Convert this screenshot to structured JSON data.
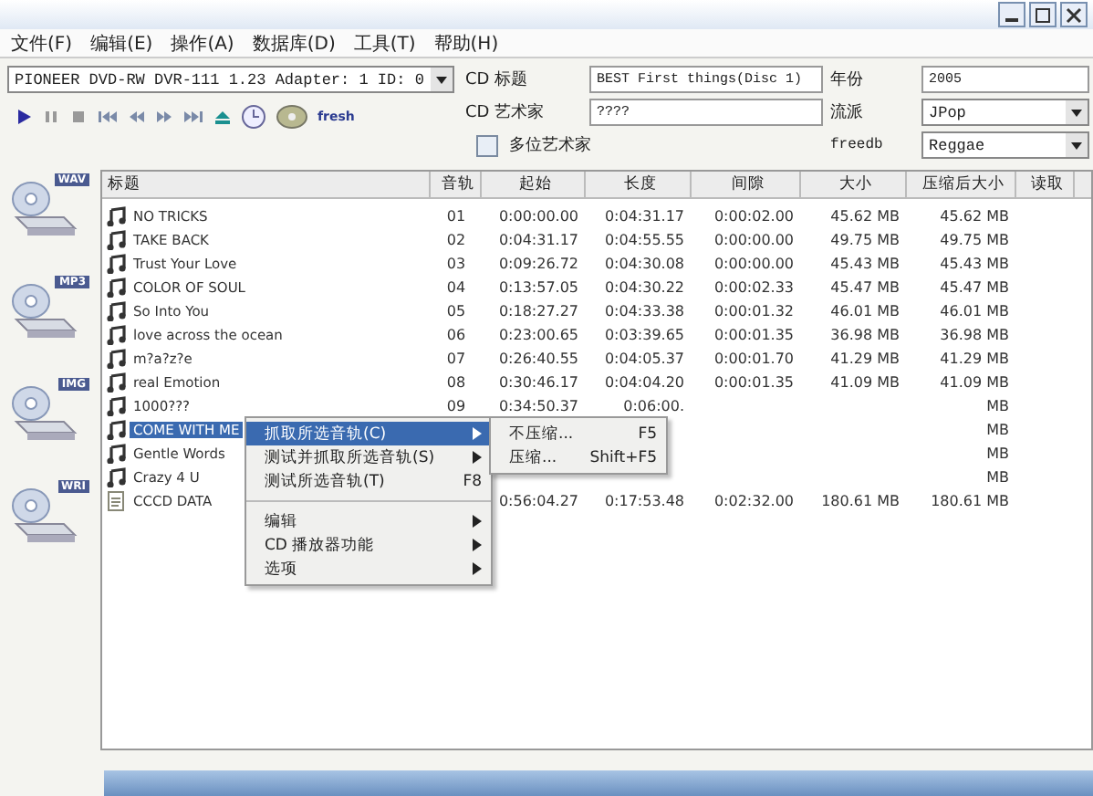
{
  "menu": [
    "文件(F)",
    "编辑(E)",
    "操作(A)",
    "数据库(D)",
    "工具(T)",
    "帮助(H)"
  ],
  "drive": {
    "value": "PIONEER DVD-RW  DVR-111 1.23   Adapter: 1  ID: 0"
  },
  "transport": [
    {
      "kind": "play"
    },
    {
      "kind": "pause"
    },
    {
      "kind": "stop"
    },
    {
      "kind": "first"
    },
    {
      "kind": "rew"
    },
    {
      "kind": "ff"
    },
    {
      "kind": "last"
    },
    {
      "kind": "eject"
    },
    {
      "kind": "clock"
    },
    {
      "kind": "cd"
    },
    {
      "kind": "text",
      "label": "fresh"
    }
  ],
  "cd_title": {
    "label": "CD 标题",
    "value": "BEST First things(Disc 1)"
  },
  "cd_artist": {
    "label": "CD 艺术家",
    "value": "????"
  },
  "multi_artist": {
    "label": "多位艺术家",
    "checked": false
  },
  "year": {
    "label": "年份",
    "value": "2005"
  },
  "genre": {
    "label": "流派",
    "value": "JPop"
  },
  "freedb": {
    "label": "freedb",
    "value": "Reggae"
  },
  "side_icons": [
    {
      "badge": "WAV"
    },
    {
      "badge": "MP3"
    },
    {
      "badge": "IMG"
    },
    {
      "badge": "WRI"
    }
  ],
  "table": {
    "columns": [
      "标题",
      "音轨",
      "起始",
      "长度",
      "间隙",
      "大小",
      "压缩后大小",
      "读取"
    ],
    "rows": [
      {
        "kind": "audio",
        "selected": false,
        "cells": [
          "NO TRICKS",
          "01",
          "0:00:00.00",
          "0:04:31.17",
          "0:00:02.00",
          "45.62 MB",
          "45.62 MB"
        ]
      },
      {
        "kind": "audio",
        "selected": false,
        "cells": [
          "TAKE BACK",
          "02",
          "0:04:31.17",
          "0:04:55.55",
          "0:00:00.00",
          "49.75 MB",
          "49.75 MB"
        ]
      },
      {
        "kind": "audio",
        "selected": false,
        "cells": [
          "Trust Your Love",
          "03",
          "0:09:26.72",
          "0:04:30.08",
          "0:00:00.00",
          "45.43 MB",
          "45.43 MB"
        ]
      },
      {
        "kind": "audio",
        "selected": false,
        "cells": [
          "COLOR OF SOUL",
          "04",
          "0:13:57.05",
          "0:04:30.22",
          "0:00:02.33",
          "45.47 MB",
          "45.47 MB"
        ]
      },
      {
        "kind": "audio",
        "selected": false,
        "cells": [
          "So Into You",
          "05",
          "0:18:27.27",
          "0:04:33.38",
          "0:00:01.32",
          "46.01 MB",
          "46.01 MB"
        ]
      },
      {
        "kind": "audio",
        "selected": false,
        "cells": [
          "love across the ocean",
          "06",
          "0:23:00.65",
          "0:03:39.65",
          "0:00:01.35",
          "36.98 MB",
          "36.98 MB"
        ]
      },
      {
        "kind": "audio",
        "selected": false,
        "cells": [
          "m?a?z?e",
          "07",
          "0:26:40.55",
          "0:04:05.37",
          "0:00:01.70",
          "41.29 MB",
          "41.29 MB"
        ]
      },
      {
        "kind": "audio",
        "selected": false,
        "cells": [
          "real Emotion",
          "08",
          "0:30:46.17",
          "0:04:04.20",
          "0:00:01.35",
          "41.09 MB",
          "41.09 MB"
        ]
      },
      {
        "kind": "audio",
        "selected": false,
        "cells": [
          "1000???",
          "09",
          "0:34:50.37",
          "0:06:00.",
          null,
          null,
          "MB"
        ]
      },
      {
        "kind": "audio",
        "selected": true,
        "cells": [
          "COME WITH ME",
          null,
          null,
          null,
          null,
          null,
          "MB"
        ]
      },
      {
        "kind": "audio",
        "selected": false,
        "cells": [
          "Gentle Words",
          null,
          null,
          null,
          null,
          null,
          "MB"
        ]
      },
      {
        "kind": "audio",
        "selected": false,
        "cells": [
          "Crazy 4 U",
          null,
          null,
          null,
          null,
          null,
          "MB"
        ]
      },
      {
        "kind": "data",
        "selected": false,
        "cells": [
          "CCCD DATA",
          null,
          "0:56:04.27",
          "0:17:53.48",
          "0:02:32.00",
          "180.61 MB",
          "180.61 MB"
        ]
      }
    ]
  },
  "context_menu": [
    {
      "label": "抓取所选音轨(C)",
      "submenu": true,
      "selected": true,
      "separator_before": false
    },
    {
      "label": "测试并抓取所选音轨(S)",
      "submenu": true,
      "selected": false,
      "separator_before": false
    },
    {
      "label": "测试所选音轨(T)",
      "shortcut": "F8",
      "submenu": false,
      "selected": false,
      "separator_before": false
    },
    {
      "label": "编辑",
      "submenu": true,
      "selected": false,
      "separator_before": true
    },
    {
      "label": "CD 播放器功能",
      "submenu": true,
      "selected": false,
      "separator_before": false
    },
    {
      "label": "选项",
      "submenu": true,
      "selected": false,
      "separator_before": false
    }
  ],
  "submenu": [
    {
      "label": "不压缩...",
      "shortcut": "F5"
    },
    {
      "label": "压缩...",
      "shortcut": "Shift+F5"
    }
  ]
}
